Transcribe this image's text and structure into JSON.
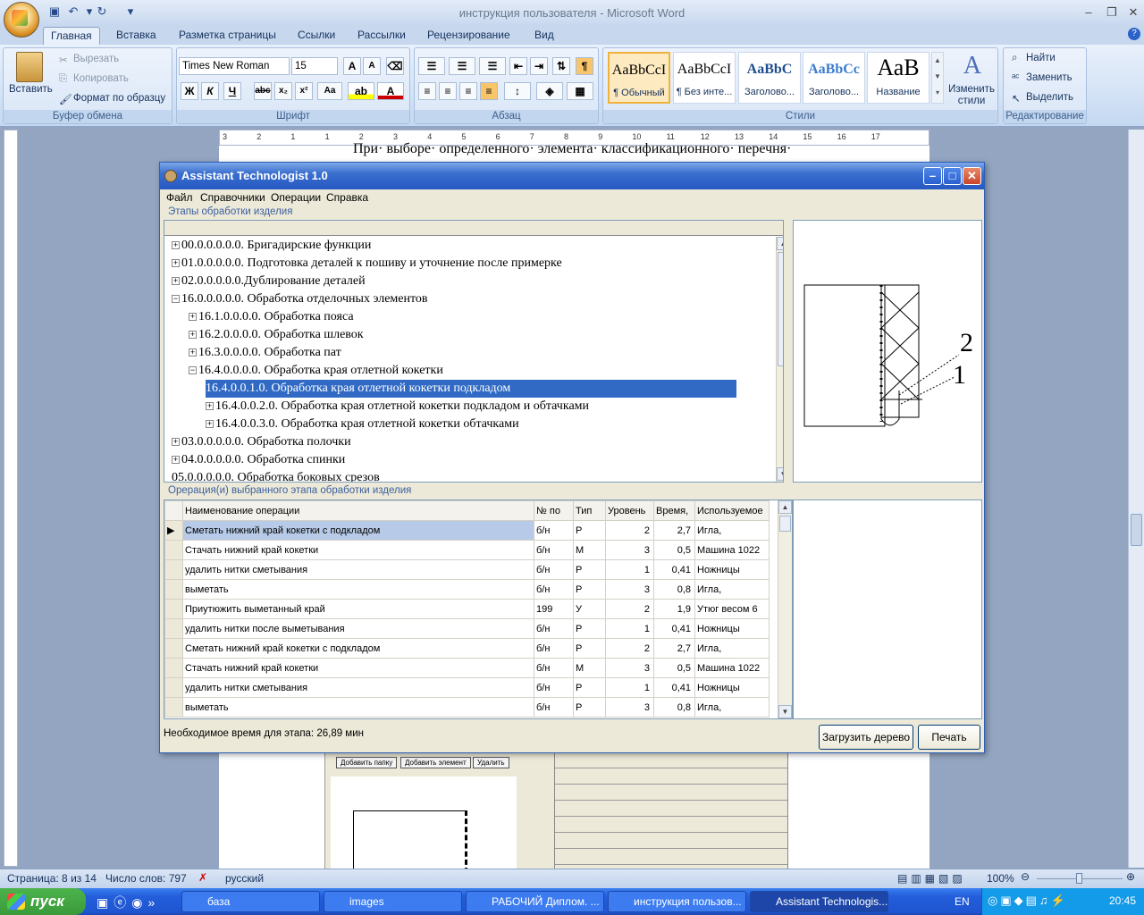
{
  "word": {
    "title": "инструкция пользователя - Microsoft Word",
    "tabs": [
      "Главная",
      "Вставка",
      "Разметка страницы",
      "Ссылки",
      "Рассылки",
      "Рецензирование",
      "Вид"
    ],
    "clipboard": {
      "paste": "Вставить",
      "cut": "Вырезать",
      "copy": "Копировать",
      "format_painter": "Формат по образцу",
      "group": "Буфер обмена"
    },
    "font": {
      "name": "Times New Roman",
      "size": "15",
      "group": "Шрифт"
    },
    "paragraph": {
      "group": "Абзац"
    },
    "styles": {
      "items": [
        {
          "preview": "AaBbCcI",
          "name": "¶ Обычный"
        },
        {
          "preview": "AaBbCcI",
          "name": "¶ Без инте..."
        },
        {
          "preview": "AaBbC",
          "name": "Заголово..."
        },
        {
          "preview": "AaBbCc",
          "name": "Заголово..."
        },
        {
          "preview": "АаВ",
          "name": "Название"
        }
      ],
      "change": "Изменить стили",
      "group": "Стили"
    },
    "editing": {
      "find": "Найти",
      "replace": "Заменить",
      "select": "Выделить",
      "group": "Редактирование"
    },
    "doc_line": "При· выборе· определенного· элемента· классификационного· перечня·",
    "ruler_numbers": [
      "3",
      "2",
      "1",
      "1",
      "2",
      "3",
      "4",
      "5",
      "6",
      "7",
      "8",
      "9",
      "10",
      "11",
      "12",
      "13",
      "14",
      "15",
      "16",
      "17"
    ],
    "status": {
      "page": "Страница: 8 из 14",
      "words": "Число слов: 797",
      "lang": "русский",
      "zoom": "100%"
    }
  },
  "app": {
    "title": "Assistant Technologist 1.0",
    "menu": [
      "Файл",
      "Справочники",
      "Операции",
      "Справка"
    ],
    "stages_label": "Этапы обработки изделия",
    "tree": [
      {
        "text": "00.0.0.0.0.0. Бригадирские функции",
        "level": 0,
        "state": "+"
      },
      {
        "text": "01.0.0.0.0.0. Подготовка деталей к пошиву и уточнение после примерке",
        "level": 0,
        "state": "+"
      },
      {
        "text": "02.0.0.0.0.0.Дублирование деталей",
        "level": 0,
        "state": "+"
      },
      {
        "text": "16.0.0.0.0.0. Обработка отделочных элементов",
        "level": 0,
        "state": "-"
      },
      {
        "text": "16.1.0.0.0.0.  Обработка пояса",
        "level": 1,
        "state": "+"
      },
      {
        "text": "16.2.0.0.0.0. Обработка шлевок",
        "level": 1,
        "state": "+"
      },
      {
        "text": "16.3.0.0.0.0. Обработка пат",
        "level": 1,
        "state": "+"
      },
      {
        "text": "16.4.0.0.0.0. Обработка края отлетной кокетки",
        "level": 1,
        "state": "-"
      },
      {
        "text": "16.4.0.0.1.0. Обработка края отлетной кокетки подкладом",
        "level": 2,
        "state": "",
        "selected": true
      },
      {
        "text": "16.4.0.0.2.0. Обработка края отлетной кокетки подкладом и обтачками",
        "level": 2,
        "state": "+"
      },
      {
        "text": "16.4.0.0.3.0.  Обработка края отлетной кокетки обтачками",
        "level": 2,
        "state": "+"
      },
      {
        "text": "03.0.0.0.0.0. Обработка полочки",
        "level": 0,
        "state": "+"
      },
      {
        "text": "04.0.0.0.0.0. Обработка спинки",
        "level": 0,
        "state": "+"
      },
      {
        "text": "05.0.0.0.0.0. Обработка боковых срезов",
        "level": 0,
        "state": ""
      }
    ],
    "ops_label": "Орерация(и) выбранного этапа обработки изделия",
    "columns": [
      "Наименование операции",
      "№ по",
      "Тип",
      "Уровень",
      "Время,",
      "Используемое"
    ],
    "rows": [
      [
        "Сметать нижний край кокетки с подкладом",
        "б/н",
        "Р",
        "2",
        "2,7",
        "Игла,"
      ],
      [
        "Стачать нижний край кокетки",
        "б/н",
        "М",
        "3",
        "0,5",
        "Машина 1022"
      ],
      [
        "удалить нитки сметывания",
        "б/н",
        "Р",
        "1",
        "0,41",
        "Ножницы"
      ],
      [
        "выметать",
        "б/н",
        "Р",
        "3",
        "0,8",
        "Игла,"
      ],
      [
        "Приутюжить выметанный край",
        "199",
        "У",
        "2",
        "1,9",
        "Утюг весом 6"
      ],
      [
        "удалить нитки после выметывания",
        "б/н",
        "Р",
        "1",
        "0,41",
        "Ножницы"
      ],
      [
        "Сметать нижний край кокетки с подкладом",
        "б/н",
        "Р",
        "2",
        "2,7",
        "Игла,"
      ],
      [
        "Стачать нижний край кокетки",
        "б/н",
        "М",
        "3",
        "0,5",
        "Машина 1022"
      ],
      [
        "удалить нитки сметывания",
        "б/н",
        "Р",
        "1",
        "0,41",
        "Ножницы"
      ],
      [
        "выметать",
        "б/н",
        "Р",
        "3",
        "0,8",
        "Игла,"
      ]
    ],
    "diagram_labels": [
      "2",
      "1"
    ],
    "footer": "Необходимое время для этапа: 26,89 мин",
    "load_btn": "Загрузить дерево",
    "print_btn": "Печать"
  },
  "behind": {
    "buttons": [
      "Добавить папку",
      "Добавить элемент",
      "Удалить"
    ]
  },
  "taskbar": {
    "start": "пуск",
    "tasks": [
      "база",
      "images",
      "РАБОЧИЙ Диплом. ...",
      "инструкция пользов...",
      "Assistant Technologis..."
    ],
    "lang": "EN",
    "time": "20:45"
  }
}
